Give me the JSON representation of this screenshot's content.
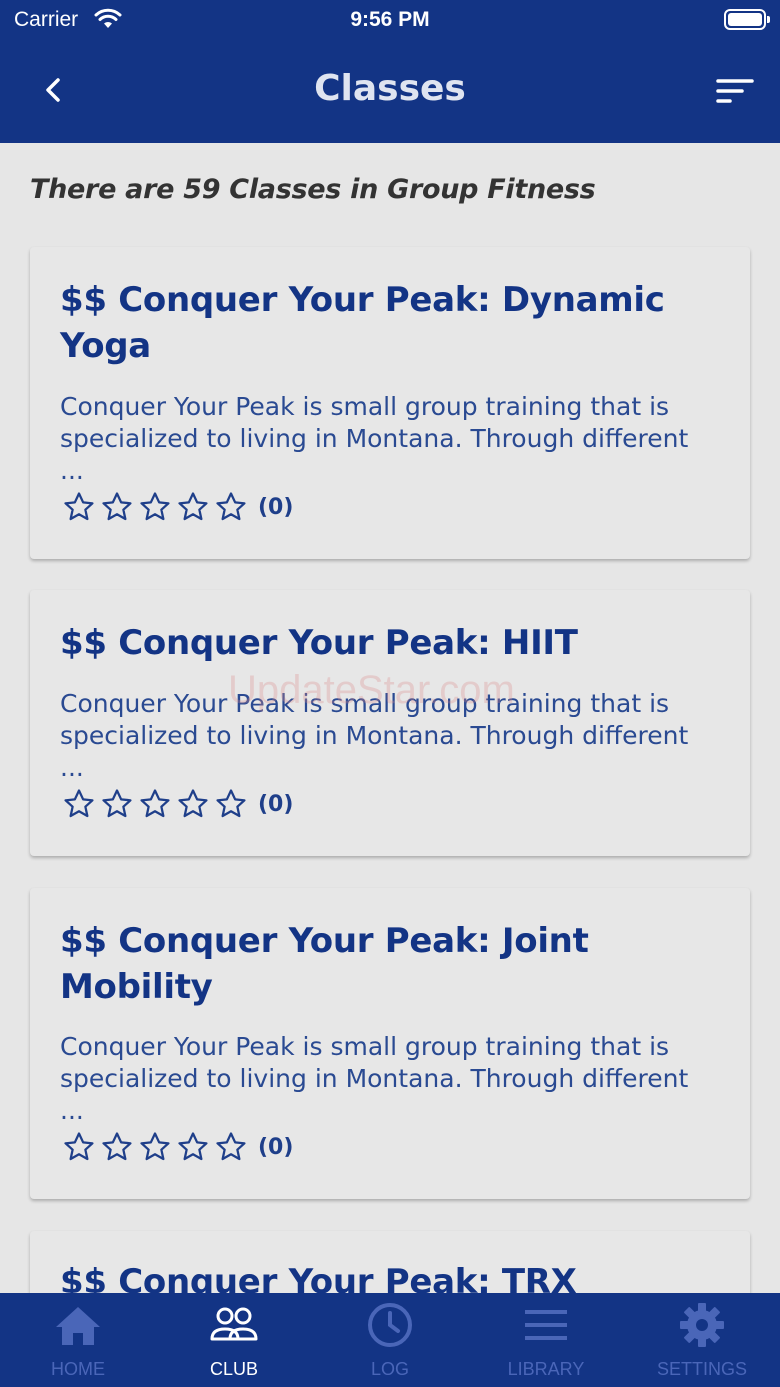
{
  "status_bar": {
    "carrier": "Carrier",
    "time": "9:56 PM"
  },
  "header": {
    "title": "Classes"
  },
  "summary": "There are 59 Classes in Group Fitness",
  "classes": [
    {
      "title": "$$ Conquer Your Peak: Dynamic Yoga",
      "description": "Conquer Your Peak is small group training that is specialized to living in Montana. Through different ...",
      "rating": 0,
      "rating_count": "(0)"
    },
    {
      "title": "$$ Conquer Your Peak: HIIT",
      "description": "Conquer Your Peak is small group training that is specialized to living in Montana. Through different ...",
      "rating": 0,
      "rating_count": "(0)"
    },
    {
      "title": "$$ Conquer Your Peak: Joint Mobility",
      "description": "Conquer Your Peak is small group training that is specialized to living in Montana. Through different ...",
      "rating": 0,
      "rating_count": "(0)"
    },
    {
      "title": "$$ Conquer Your Peak: TRX"
    }
  ],
  "watermark": "UpdateStar.com",
  "tabs": [
    {
      "label": "HOME",
      "icon": "home-icon",
      "active": false
    },
    {
      "label": "CLUB",
      "icon": "people-icon",
      "active": true
    },
    {
      "label": "LOG",
      "icon": "clock-icon",
      "active": false
    },
    {
      "label": "LIBRARY",
      "icon": "list-icon",
      "active": false
    },
    {
      "label": "SETTINGS",
      "icon": "gear-icon",
      "active": false
    }
  ],
  "colors": {
    "primary": "#133485",
    "background": "#e6e6e6",
    "tab_active": "#ffffff",
    "tab_inactive": "#4a66b8"
  }
}
